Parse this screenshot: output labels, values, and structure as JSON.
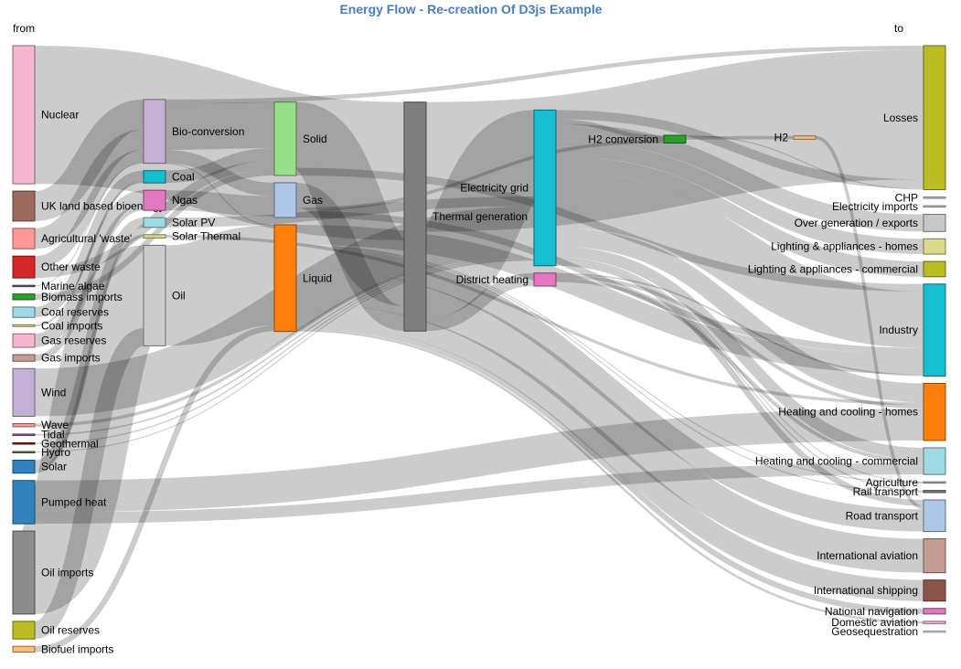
{
  "title": "Energy Flow - Re-creation Of D3js Example",
  "from_label": "from",
  "to_label": "to",
  "chart_data": {
    "type": "sankey",
    "title": "Energy Flow - Re-creation Of D3js Example",
    "link_color": "#cccccc",
    "nodes": [
      {
        "id": "nuclear",
        "name": "Nuclear",
        "color": "#f7b6d2",
        "column": 0
      },
      {
        "id": "uk_bio",
        "name": "UK land based bioenergy",
        "color": "#9c6b5e",
        "column": 0
      },
      {
        "id": "agri_waste",
        "name": "Agricultural 'waste'",
        "color": "#ff9896",
        "column": 0
      },
      {
        "id": "other_waste",
        "name": "Other waste",
        "color": "#d62728",
        "column": 0
      },
      {
        "id": "marine_algae",
        "name": "Marine algae",
        "color": "#7b5f8c",
        "column": 0
      },
      {
        "id": "biomass_imports",
        "name": "Biomass imports",
        "color": "#2ca02c",
        "column": 0
      },
      {
        "id": "coal_reserves",
        "name": "Coal reserves",
        "color": "#9edae5",
        "column": 0
      },
      {
        "id": "coal_imports",
        "name": "Coal imports",
        "color": "#dbdb8d",
        "column": 0
      },
      {
        "id": "gas_reserves",
        "name": "Gas reserves",
        "color": "#f7b6d2",
        "column": 0
      },
      {
        "id": "gas_imports",
        "name": "Gas imports",
        "color": "#c49c94",
        "column": 0
      },
      {
        "id": "wind",
        "name": "Wind",
        "color": "#c5b0d5",
        "column": 0
      },
      {
        "id": "wave",
        "name": "Wave",
        "color": "#ff9896",
        "column": 0
      },
      {
        "id": "tidal",
        "name": "Tidal",
        "color": "#9467bd",
        "column": 0
      },
      {
        "id": "geothermal",
        "name": "Geothermal",
        "color": "#8c1c1c",
        "column": 0
      },
      {
        "id": "hydro",
        "name": "Hydro",
        "color": "#5a8c4a",
        "column": 0
      },
      {
        "id": "solar",
        "name": "Solar",
        "color": "#3182bd",
        "column": 0
      },
      {
        "id": "pumped_heat",
        "name": "Pumped heat",
        "color": "#3182bd",
        "column": 0
      },
      {
        "id": "oil_imports",
        "name": "Oil imports",
        "color": "#8c8c8c",
        "column": 0
      },
      {
        "id": "oil_reserves",
        "name": "Oil reserves",
        "color": "#bcbd22",
        "column": 0
      },
      {
        "id": "biofuel_imports",
        "name": "Biofuel imports",
        "color": "#ffbb78",
        "column": 0
      },
      {
        "id": "bio_conversion",
        "name": "Bio-conversion",
        "color": "#c5b0d5",
        "column": 1
      },
      {
        "id": "coal",
        "name": "Coal",
        "color": "#17becf",
        "column": 1
      },
      {
        "id": "ngas",
        "name": "Ngas",
        "color": "#e377c2",
        "column": 1
      },
      {
        "id": "solar_pv",
        "name": "Solar PV",
        "color": "#9edae5",
        "column": 1
      },
      {
        "id": "solar_thermal",
        "name": "Solar Thermal",
        "color": "#dbdb8d",
        "column": 1
      },
      {
        "id": "oil",
        "name": "Oil",
        "color": "#cccccc",
        "column": 1
      },
      {
        "id": "solid",
        "name": "Solid",
        "color": "#98df8a",
        "column": 2
      },
      {
        "id": "gas",
        "name": "Gas",
        "color": "#aec7e8",
        "column": 2
      },
      {
        "id": "liquid",
        "name": "Liquid",
        "color": "#ff7f0e",
        "column": 2
      },
      {
        "id": "thermal_gen",
        "name": "Thermal generation",
        "color": "#7f7f7f",
        "column": 3
      },
      {
        "id": "elec_grid",
        "name": "Electricity grid",
        "color": "#17becf",
        "column": 4
      },
      {
        "id": "district_heating",
        "name": "District heating",
        "color": "#e377c2",
        "column": 4
      },
      {
        "id": "h2_conversion",
        "name": "H2 conversion",
        "color": "#2ca02c",
        "column": 5
      },
      {
        "id": "h2",
        "name": "H2",
        "color": "#ffbb78",
        "column": 6
      },
      {
        "id": "losses",
        "name": "Losses",
        "color": "#bcbd22",
        "column": 7
      },
      {
        "id": "chp",
        "name": "CHP",
        "color": "#dddddd",
        "column": 7
      },
      {
        "id": "elec_imports",
        "name": "Electricity imports",
        "color": "#dddddd",
        "column": 7
      },
      {
        "id": "over_gen",
        "name": "Over generation / exports",
        "color": "#c7c7c7",
        "column": 7
      },
      {
        "id": "light_homes",
        "name": "Lighting & appliances - homes",
        "color": "#dbdb8d",
        "column": 7
      },
      {
        "id": "light_comm",
        "name": "Lighting & appliances - commercial",
        "color": "#bcbd22",
        "column": 7
      },
      {
        "id": "industry",
        "name": "Industry",
        "color": "#17becf",
        "column": 7
      },
      {
        "id": "heat_homes",
        "name": "Heating and cooling - homes",
        "color": "#ff7f0e",
        "column": 7
      },
      {
        "id": "heat_comm",
        "name": "Heating and cooling - commercial",
        "color": "#9edae5",
        "column": 7
      },
      {
        "id": "agriculture",
        "name": "Agriculture",
        "color": "#c7c7c7",
        "column": 7
      },
      {
        "id": "rail",
        "name": "Rail transport",
        "color": "#7f7f7f",
        "column": 7
      },
      {
        "id": "road",
        "name": "Road transport",
        "color": "#aec7e8",
        "column": 7
      },
      {
        "id": "intl_aviation",
        "name": "International aviation",
        "color": "#c49c94",
        "column": 7
      },
      {
        "id": "intl_shipping",
        "name": "International shipping",
        "color": "#8c564b",
        "column": 7
      },
      {
        "id": "national_nav",
        "name": "National navigation",
        "color": "#e377c2",
        "column": 7
      },
      {
        "id": "domestic_aviation",
        "name": "Domestic aviation",
        "color": "#f7b6d2",
        "column": 7
      },
      {
        "id": "geoseq",
        "name": "Geosequestration",
        "color": "#ffffff",
        "column": 7
      }
    ],
    "links": [
      {
        "source": "nuclear",
        "target": "thermal_gen",
        "value": 839
      },
      {
        "source": "uk_bio",
        "target": "bio_conversion",
        "value": 182
      },
      {
        "source": "agri_waste",
        "target": "bio_conversion",
        "value": 124
      },
      {
        "source": "other_waste",
        "target": "bio_conversion",
        "value": 77
      },
      {
        "source": "other_waste",
        "target": "solid",
        "value": 56
      },
      {
        "source": "marine_algae",
        "target": "bio_conversion",
        "value": 4
      },
      {
        "source": "biomass_imports",
        "target": "solid",
        "value": 35
      },
      {
        "source": "coal_reserves",
        "target": "coal",
        "value": 63
      },
      {
        "source": "coal_imports",
        "target": "coal",
        "value": 11
      },
      {
        "source": "gas_reserves",
        "target": "ngas",
        "value": 82
      },
      {
        "source": "gas_imports",
        "target": "ngas",
        "value": 40
      },
      {
        "source": "wind",
        "target": "elec_grid",
        "value": 290
      },
      {
        "source": "wave",
        "target": "elec_grid",
        "value": 19
      },
      {
        "source": "tidal",
        "target": "elec_grid",
        "value": 9
      },
      {
        "source": "geothermal",
        "target": "elec_grid",
        "value": 7
      },
      {
        "source": "hydro",
        "target": "elec_grid",
        "value": 6
      },
      {
        "source": "solar",
        "target": "solar_pv",
        "value": 59
      },
      {
        "source": "solar",
        "target": "solar_thermal",
        "value": 20
      },
      {
        "source": "pumped_heat",
        "target": "heat_homes",
        "value": 193
      },
      {
        "source": "pumped_heat",
        "target": "heat_comm",
        "value": 70
      },
      {
        "source": "oil_imports",
        "target": "oil",
        "value": 504
      },
      {
        "source": "oil_reserves",
        "target": "oil",
        "value": 107
      },
      {
        "source": "biofuel_imports",
        "target": "liquid",
        "value": 35
      },
      {
        "source": "bio_conversion",
        "target": "solid",
        "value": 280
      },
      {
        "source": "bio_conversion",
        "target": "gas",
        "value": 81
      },
      {
        "source": "bio_conversion",
        "target": "liquid",
        "value": 0.6
      },
      {
        "source": "bio_conversion",
        "target": "losses",
        "value": 26
      },
      {
        "source": "coal",
        "target": "solid",
        "value": 75
      },
      {
        "source": "ngas",
        "target": "gas",
        "value": 122
      },
      {
        "source": "solar_pv",
        "target": "elec_grid",
        "value": 59
      },
      {
        "source": "solar_thermal",
        "target": "heat_homes",
        "value": 19
      },
      {
        "source": "oil",
        "target": "liquid",
        "value": 611
      },
      {
        "source": "solid",
        "target": "thermal_gen",
        "value": 400
      },
      {
        "source": "solid",
        "target": "industry",
        "value": 46
      },
      {
        "source": "gas",
        "target": "thermal_gen",
        "value": 151
      },
      {
        "source": "gas",
        "target": "industry",
        "value": 40
      },
      {
        "source": "gas",
        "target": "h2_conversion",
        "value": 20
      },
      {
        "source": "liquid",
        "target": "industry",
        "value": 121
      },
      {
        "source": "liquid",
        "target": "road",
        "value": 135
      },
      {
        "source": "liquid",
        "target": "intl_aviation",
        "value": 206
      },
      {
        "source": "liquid",
        "target": "intl_shipping",
        "value": 128
      },
      {
        "source": "liquid",
        "target": "national_nav",
        "value": 34
      },
      {
        "source": "liquid",
        "target": "domestic_aviation",
        "value": 14
      },
      {
        "source": "liquid",
        "target": "agriculture",
        "value": 4
      },
      {
        "source": "liquid",
        "target": "rail",
        "value": 6
      },
      {
        "source": "thermal_gen",
        "target": "elec_grid",
        "value": 525
      },
      {
        "source": "thermal_gen",
        "target": "losses",
        "value": 787
      },
      {
        "source": "thermal_gen",
        "target": "district_heating",
        "value": 79
      },
      {
        "source": "elec_grid",
        "target": "over_gen",
        "value": 104
      },
      {
        "source": "elec_grid",
        "target": "h2_conversion",
        "value": 27
      },
      {
        "source": "elec_grid",
        "target": "light_homes",
        "value": 93
      },
      {
        "source": "elec_grid",
        "target": "light_comm",
        "value": 93
      },
      {
        "source": "elec_grid",
        "target": "industry",
        "value": 342
      },
      {
        "source": "elec_grid",
        "target": "road",
        "value": 37
      },
      {
        "source": "elec_grid",
        "target": "heat_homes",
        "value": 113
      },
      {
        "source": "elec_grid",
        "target": "heat_comm",
        "value": 70
      },
      {
        "source": "elec_grid",
        "target": "agriculture",
        "value": 4
      },
      {
        "source": "elec_grid",
        "target": "rail",
        "value": 7
      },
      {
        "source": "elec_grid",
        "target": "losses",
        "value": 56
      },
      {
        "source": "district_heating",
        "target": "industry",
        "value": 10
      },
      {
        "source": "district_heating",
        "target": "heat_homes",
        "value": 22
      },
      {
        "source": "district_heating",
        "target": "heat_comm",
        "value": 22
      },
      {
        "source": "h2_conversion",
        "target": "h2",
        "value": 20
      },
      {
        "source": "h2_conversion",
        "target": "losses",
        "value": 6
      },
      {
        "source": "h2",
        "target": "road",
        "value": 20
      }
    ]
  }
}
